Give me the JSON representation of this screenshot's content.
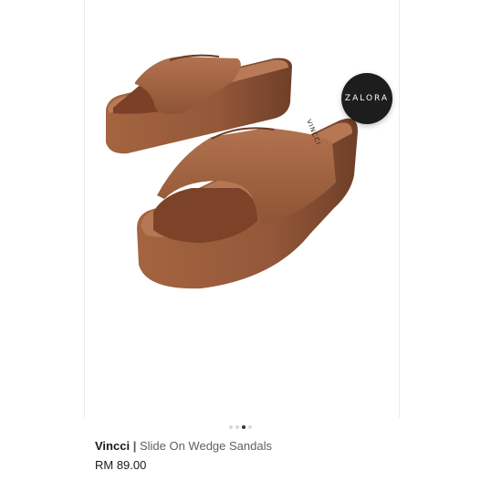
{
  "badge": {
    "text": "ZALORA"
  },
  "product": {
    "brand": "Vincci",
    "separator": "|",
    "name": "Slide On Wedge Sandals",
    "price": "RM 89.00",
    "insole_print": "VINCCI"
  },
  "gallery": {
    "slide_count": 4,
    "active_index": 2
  },
  "colors": {
    "leather": "#9a5a38",
    "badge": "#1d1d1d",
    "dot_active": "#333333",
    "dot_inactive": "#d8d8d8"
  }
}
